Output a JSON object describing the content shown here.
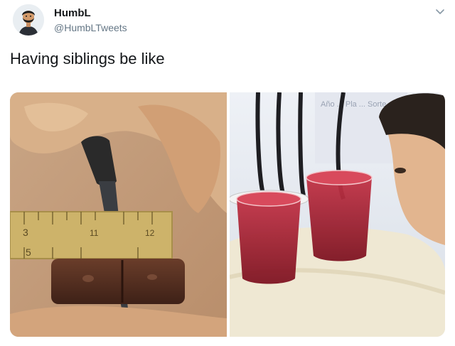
{
  "tweet": {
    "author_name": "HumbL",
    "author_handle": "@HumbLTweets",
    "text": "Having siblings be like"
  },
  "icons": {
    "menu": "chevron-down-icon",
    "avatar": "avatar"
  },
  "media": {
    "ruler_numbers": [
      "3",
      "11",
      "12",
      "5"
    ],
    "background_sign": "Año ... Pla ... Sorte ... ne"
  },
  "colors": {
    "name": "#14171a",
    "handle": "#657786",
    "drink": "#9e1c2e"
  }
}
